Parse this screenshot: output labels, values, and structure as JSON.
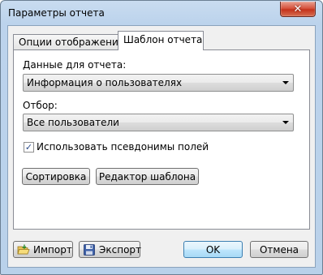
{
  "window": {
    "title": "Параметры отчета",
    "close_symbol": "✕"
  },
  "tabs": [
    {
      "label": "Опции отображения",
      "active": false
    },
    {
      "label": "Шаблон отчета",
      "active": true
    }
  ],
  "panel": {
    "data_label": "Данные для отчета:",
    "data_value": "Информация о пользователях",
    "filter_label": "Отбор:",
    "filter_value": "Все пользователи",
    "aliases_label": "Использовать псевдонимы полей",
    "aliases_checked": true,
    "sort_button": "Сортировка",
    "template_editor_button": "Редактор шаблона"
  },
  "footer": {
    "import_button": "Импорт",
    "export_button": "Экспорт",
    "ok_button": "OK",
    "cancel_button": "Отмена"
  },
  "icons": {
    "import": "folder-open-icon",
    "export": "floppy-disk-icon",
    "checkbox": "checkmark-icon"
  },
  "colors": {
    "title_bar": "#bcd3ec",
    "close_button": "#c4331c",
    "focus_button": "#3c7fb1"
  }
}
